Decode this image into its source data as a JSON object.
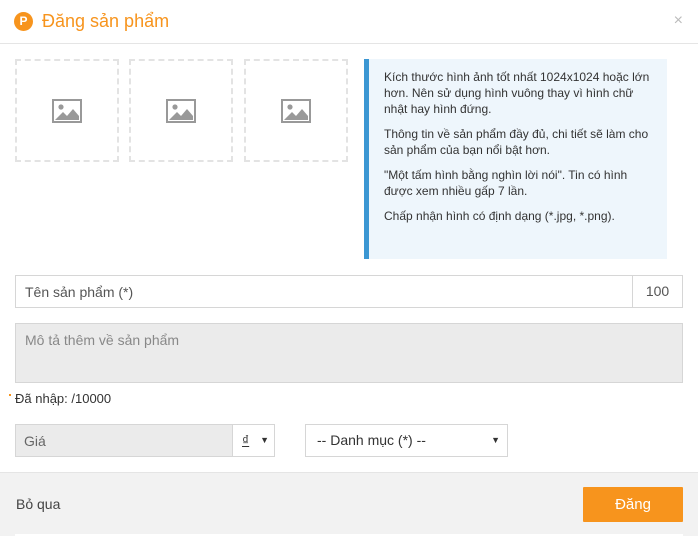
{
  "header": {
    "logo_letter": "P",
    "title": "Đăng sản phẩm",
    "close_label": "×"
  },
  "image_slots": [
    {
      "icon": "image-placeholder-icon"
    },
    {
      "icon": "image-placeholder-icon"
    },
    {
      "icon": "image-placeholder-icon"
    }
  ],
  "info": {
    "lines": [
      "Kích thước hình ảnh tốt nhất 1024x1024 hoặc lớn hơn. Nên sử dụng hình vuông thay vì hình chữ nhật hay hình đứng.",
      "Thông tin về sản phẩm đầy đủ, chi tiết sẽ làm cho sản phẩm của bạn nổi bật hơn.",
      "\"Một tấm hình bằng nghìn lời nói\". Tin có hình được xem nhiều gấp 7 lần.",
      "Chấp nhận hình có định dạng (*.jpg, *.png)."
    ]
  },
  "form": {
    "name_placeholder": "Tên sản phẩm (*)",
    "name_value": "",
    "name_remaining": "100",
    "description_placeholder": "Mô tả thêm về sản phẩm",
    "description_value": "",
    "entered_count": "Đã nhập: /10000",
    "price_placeholder": "Giá",
    "price_value": "",
    "currency_symbol": "₫",
    "category_selected": "-- Danh mục (*) --"
  },
  "footer": {
    "skip_label": "Bỏ qua",
    "submit_label": "Đăng"
  },
  "colors": {
    "accent": "#f7941d",
    "info_border": "#3b97d3",
    "info_bg": "#eef6fc"
  }
}
